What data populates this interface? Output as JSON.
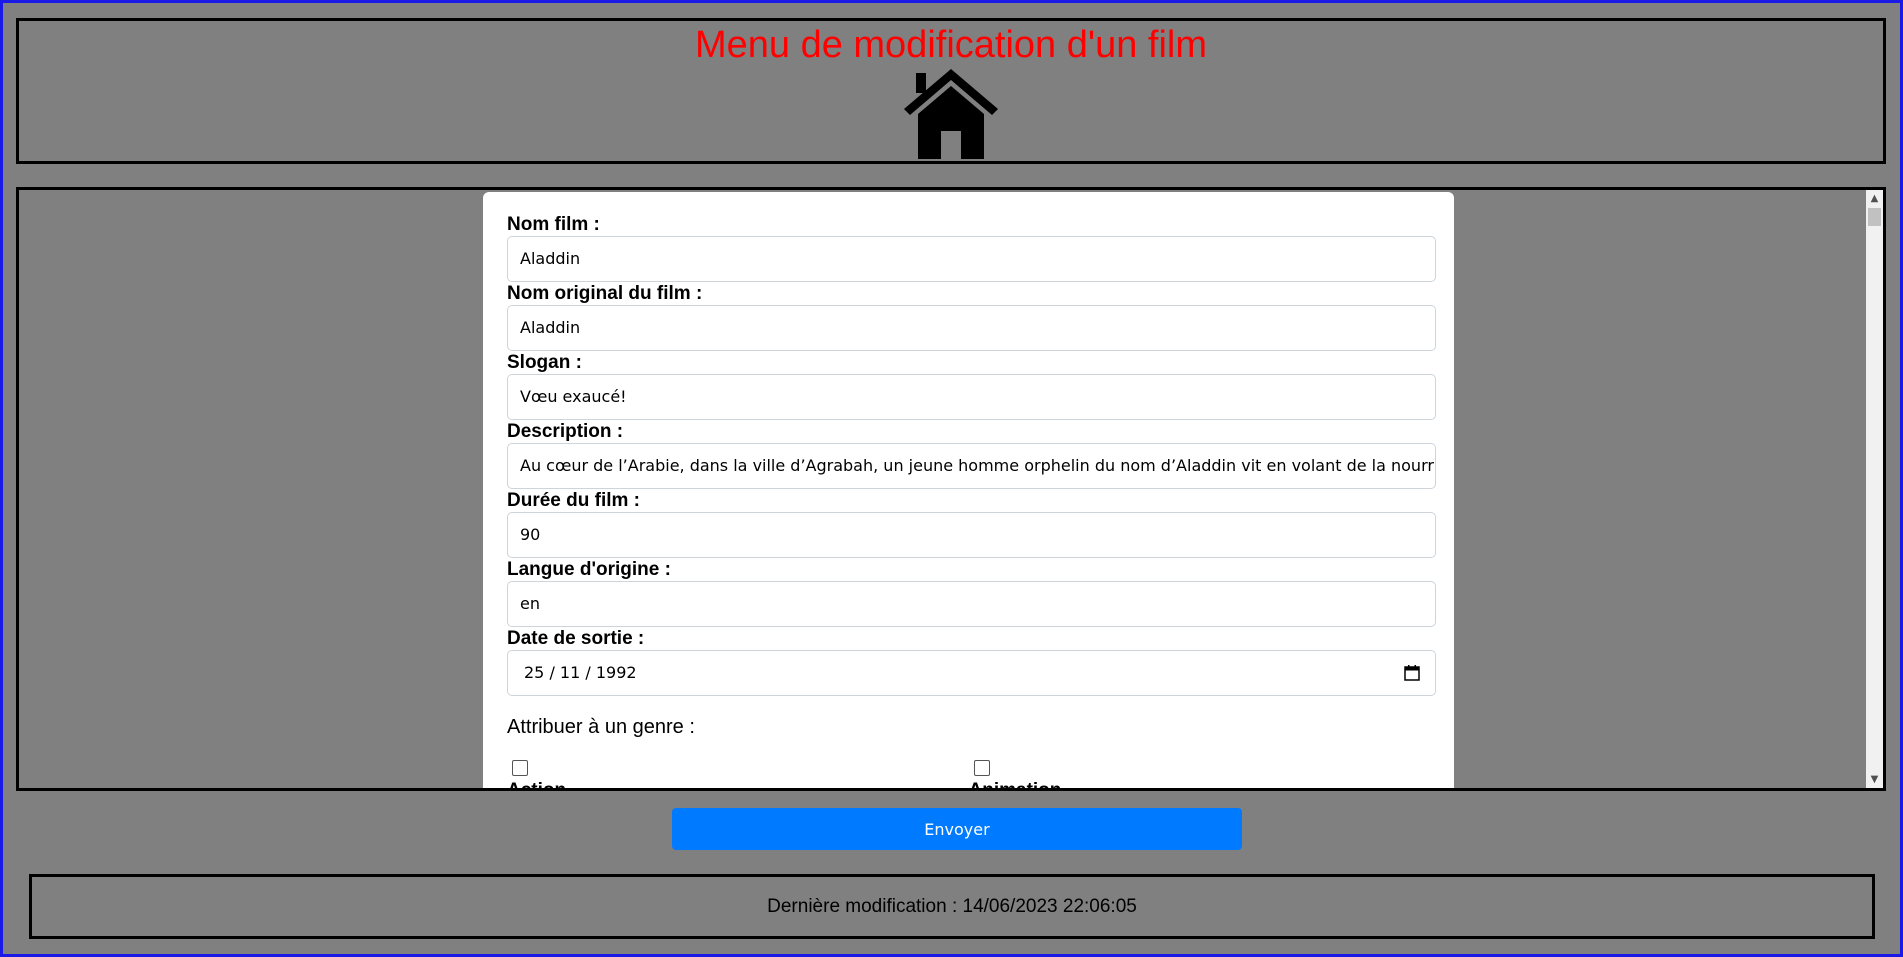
{
  "header": {
    "title": "Menu de modification d'un film",
    "home_icon": "house-icon"
  },
  "form": {
    "fields": [
      {
        "label": "Nom film :",
        "value": "Aladdin"
      },
      {
        "label": "Nom original du film :",
        "value": "Aladdin"
      },
      {
        "label": "Slogan :",
        "value": "Vœu exaucé!"
      },
      {
        "label": "Description :",
        "value": "Au cœur de l’Arabie, dans la ville d’Agrabah, un jeune homme orphelin du nom d’Aladdin vit en volant de la nourriture aux"
      },
      {
        "label": "Durée du film :",
        "value": "90"
      },
      {
        "label": "Langue d'origine :",
        "value": "en"
      }
    ],
    "date": {
      "label": "Date de sortie :",
      "value": "25 / 11 / 1992",
      "icon": "calendar-icon"
    },
    "genre_title": "Attribuer à un genre :",
    "genres": [
      {
        "label": "Action",
        "checked": false
      },
      {
        "label": "Animation",
        "checked": false
      }
    ]
  },
  "submit_label": "Envoyer",
  "footer": {
    "text": "Dernière modification : 14/06/2023 22:06:05"
  },
  "colors": {
    "title": "#ff0000",
    "button": "#007bff",
    "background": "#808080",
    "outer_border": "#1a1ae6"
  }
}
